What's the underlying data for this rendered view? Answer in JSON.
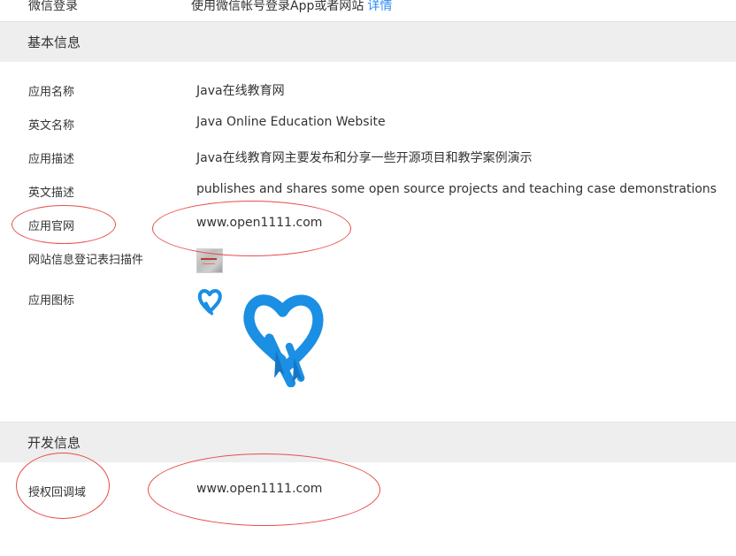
{
  "wechat_login": {
    "label": "微信登录",
    "value": "使用微信帐号登录App或者网站",
    "link": "详情"
  },
  "basic_info": {
    "title": "基本信息",
    "fields": [
      {
        "label": "应用名称",
        "value": "Java在线教育网"
      },
      {
        "label": "英文名称",
        "value": "Java Online Education Website"
      },
      {
        "label": "应用描述",
        "value": "Java在线教育网主要发布和分享一些开源项目和教学案例演示"
      },
      {
        "label": "英文描述",
        "value": "publishes and shares some open source projects and teaching case demonstrations"
      },
      {
        "label": "应用官网",
        "value": "www.open1111.com"
      },
      {
        "label": "网站信息登记表扫描件",
        "value": ""
      },
      {
        "label": "应用图标",
        "value": ""
      }
    ]
  },
  "dev_info": {
    "title": "开发信息",
    "fields": [
      {
        "label": "授权回调域",
        "value": "www.open1111.com"
      }
    ]
  },
  "colors": {
    "header_bg": "#eeeeee",
    "link": "#2d8cf0",
    "annotation": "#e74c4c",
    "logo": "#1a8fe3"
  },
  "icons": [
    "scan-thumbnail-icon",
    "app-logo-small-icon",
    "app-logo-large-icon"
  ]
}
